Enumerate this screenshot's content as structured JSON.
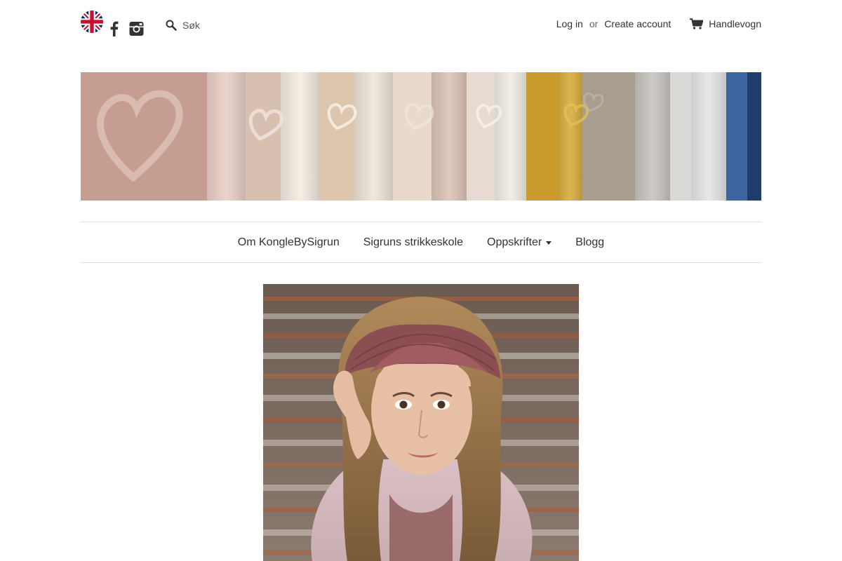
{
  "header": {
    "language_flag": "uk-flag-icon",
    "social": [
      "facebook-icon",
      "instagram-icon"
    ],
    "search": {
      "placeholder": "Søk",
      "icon": "search-icon"
    },
    "account": {
      "login_label": "Log in",
      "or_label": "or",
      "create_label": "Create account"
    },
    "cart": {
      "icon": "cart-icon",
      "label": "Handlevogn"
    }
  },
  "banner": {
    "description_icon": "knitted-hearts-banner"
  },
  "nav": {
    "items": [
      {
        "label": "Om KongleBySigrun"
      },
      {
        "label": "Sigruns strikkeskole"
      },
      {
        "label": "Oppskrifter",
        "has_dropdown": true
      },
      {
        "label": "Blogg"
      }
    ]
  },
  "hero": {
    "icon": "headband-photo"
  },
  "colors": {
    "text": "#333333",
    "border": "#e2e2e2",
    "background": "#ffffff"
  }
}
